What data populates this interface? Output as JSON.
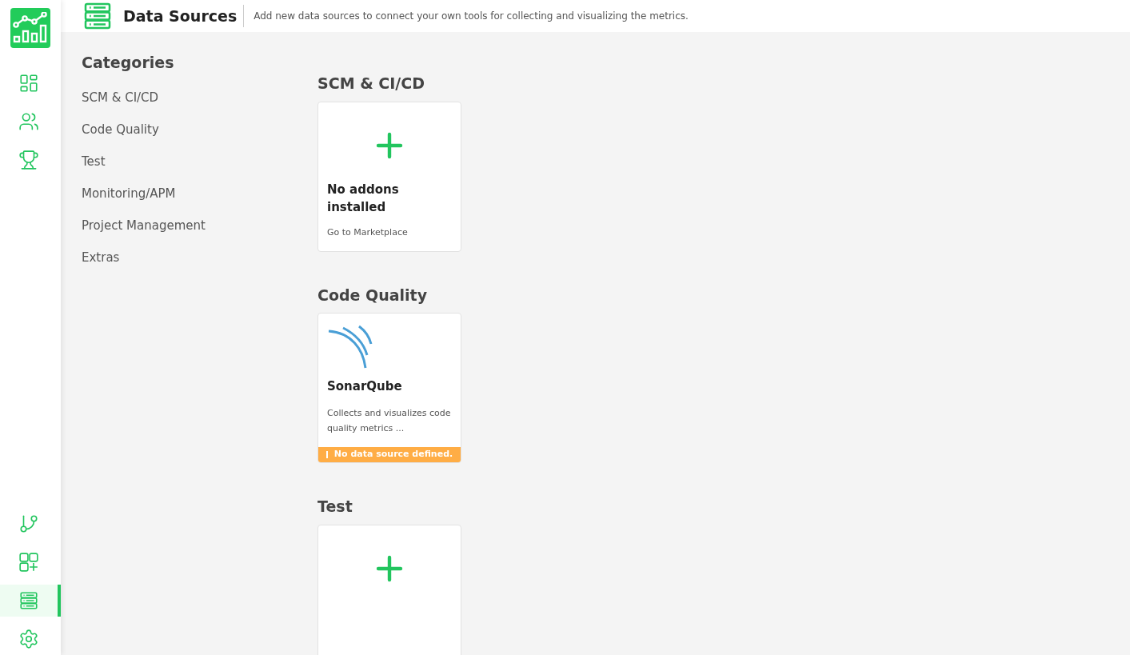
{
  "sidebar": {
    "items": [
      {
        "kind": "dashboard",
        "selected": false
      },
      {
        "kind": "team",
        "selected": false
      },
      {
        "kind": "trophy",
        "selected": false
      }
    ],
    "bottom_items": [
      {
        "kind": "branch",
        "selected": false
      },
      {
        "kind": "addons",
        "selected": false
      },
      {
        "kind": "datasources",
        "selected": true
      },
      {
        "kind": "settings",
        "selected": false
      }
    ]
  },
  "header": {
    "title": "Data Sources",
    "subtitle": "Add new data sources to connect your own tools for collecting and visualizing the metrics."
  },
  "categories": {
    "title": "Categories",
    "items": [
      "SCM & CI/CD",
      "Code Quality",
      "Test",
      "Monitoring/APM",
      "Project Management",
      "Extras"
    ]
  },
  "sections": [
    {
      "title": "SCM & CI/CD",
      "cards": [
        {
          "kind": "empty",
          "title": "No addons installed",
          "link": "Go to Marketplace"
        }
      ]
    },
    {
      "title": "Code Quality",
      "cards": [
        {
          "kind": "addon",
          "title": "SonarQube",
          "description": "Collects and visualizes code quality metrics ...",
          "warning": "No data source defined."
        }
      ]
    },
    {
      "title": "Test",
      "cards": [
        {
          "kind": "empty"
        }
      ]
    }
  ]
}
